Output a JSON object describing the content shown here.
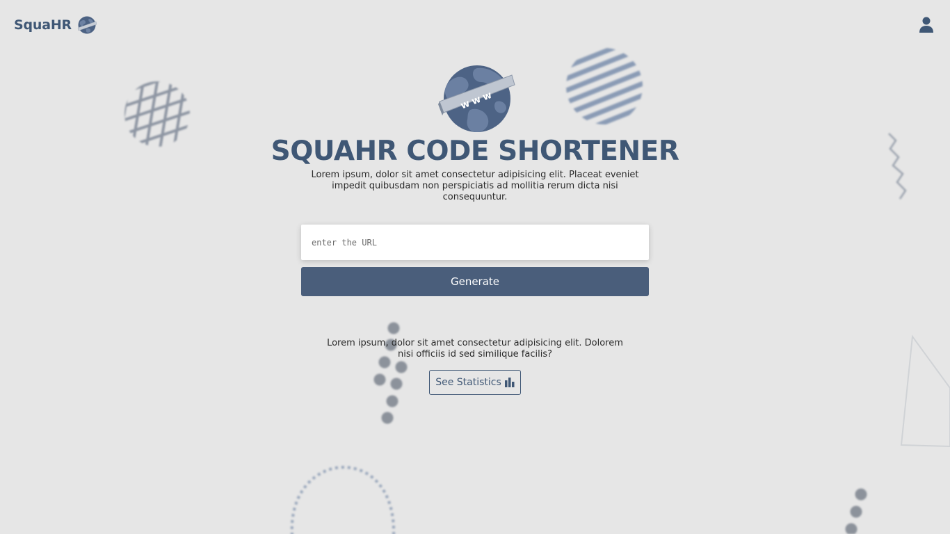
{
  "header": {
    "brand_name": "SquaHR",
    "logo_icon": "globe-www-icon",
    "user_icon": "user-icon"
  },
  "hero": {
    "icon": "globe-www-icon",
    "globe_banner_text": "www",
    "title": "SQUAHR CODE SHORTENER",
    "subtitle": "Lorem ipsum, dolor sit amet consectetur adipisicing elit. Placeat eveniet impedit quibusdam non perspiciatis ad mollitia rerum dicta nisi consequuntur."
  },
  "form": {
    "url_placeholder": "enter the URL",
    "url_value": "",
    "generate_label": "Generate"
  },
  "stats": {
    "text": "Lorem ipsum, dolor sit amet consectetur adipisicing elit. Dolorem nisi officiis id sed similique facilis?",
    "button_label": "See Statistics",
    "button_icon": "bar-chart-icon"
  },
  "colors": {
    "background": "#e6e6e6",
    "primary": "#4a5e7b",
    "title": "#3f5775",
    "decor": "#8893a3"
  }
}
